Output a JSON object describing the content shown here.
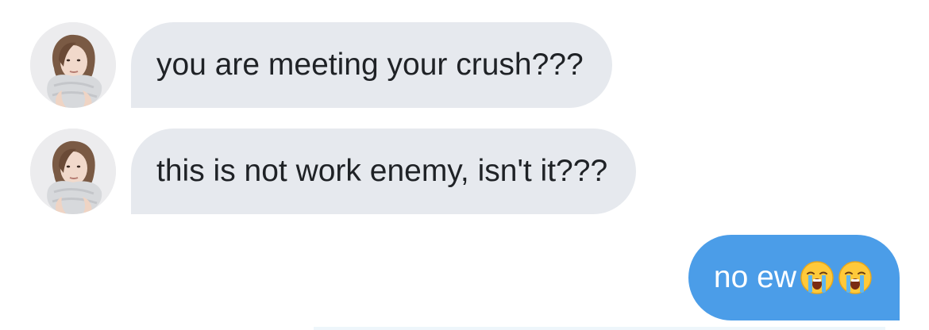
{
  "conversation": {
    "messages": [
      {
        "sender": "contact",
        "text": "you are meeting your crush???"
      },
      {
        "sender": "contact",
        "text": "this is not work enemy, isn't it???"
      },
      {
        "sender": "me",
        "text": "no ew",
        "emojis": [
          "loudly-crying-face",
          "loudly-crying-face"
        ]
      }
    ]
  },
  "colors": {
    "incoming_bubble": "#e6e9ee",
    "incoming_text": "#1f2226",
    "outgoing_bubble": "#4b9de8",
    "outgoing_text": "#ffffff"
  }
}
